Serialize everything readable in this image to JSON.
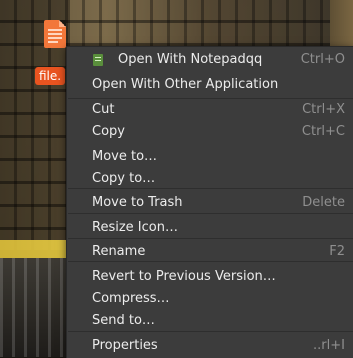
{
  "desktop": {
    "file_label": "file."
  },
  "context_menu": {
    "items": [
      {
        "label": "Open With Notepadqq",
        "accel": "Ctrl+O",
        "icon": "notepadqq-icon"
      },
      {
        "label": "Open With Other Application",
        "accel": ""
      },
      {
        "label": "Cut",
        "accel": "Ctrl+X"
      },
      {
        "label": "Copy",
        "accel": "Ctrl+C"
      },
      {
        "label": "Move to…",
        "accel": ""
      },
      {
        "label": "Copy to…",
        "accel": ""
      },
      {
        "label": "Move to Trash",
        "accel": "Delete"
      },
      {
        "label": "Resize Icon…",
        "accel": ""
      },
      {
        "label": "Rename",
        "accel": "F2"
      },
      {
        "label": "Revert to Previous Version…",
        "accel": ""
      },
      {
        "label": "Compress…",
        "accel": ""
      },
      {
        "label": "Send to…",
        "accel": ""
      },
      {
        "label": "Properties",
        "accel": "..rl+I"
      }
    ]
  },
  "colors": {
    "menu_bg": "#3c3c3c",
    "menu_text": "#ececec",
    "accel_text": "#8f8f8f",
    "file_label_bg": "#e95420"
  }
}
